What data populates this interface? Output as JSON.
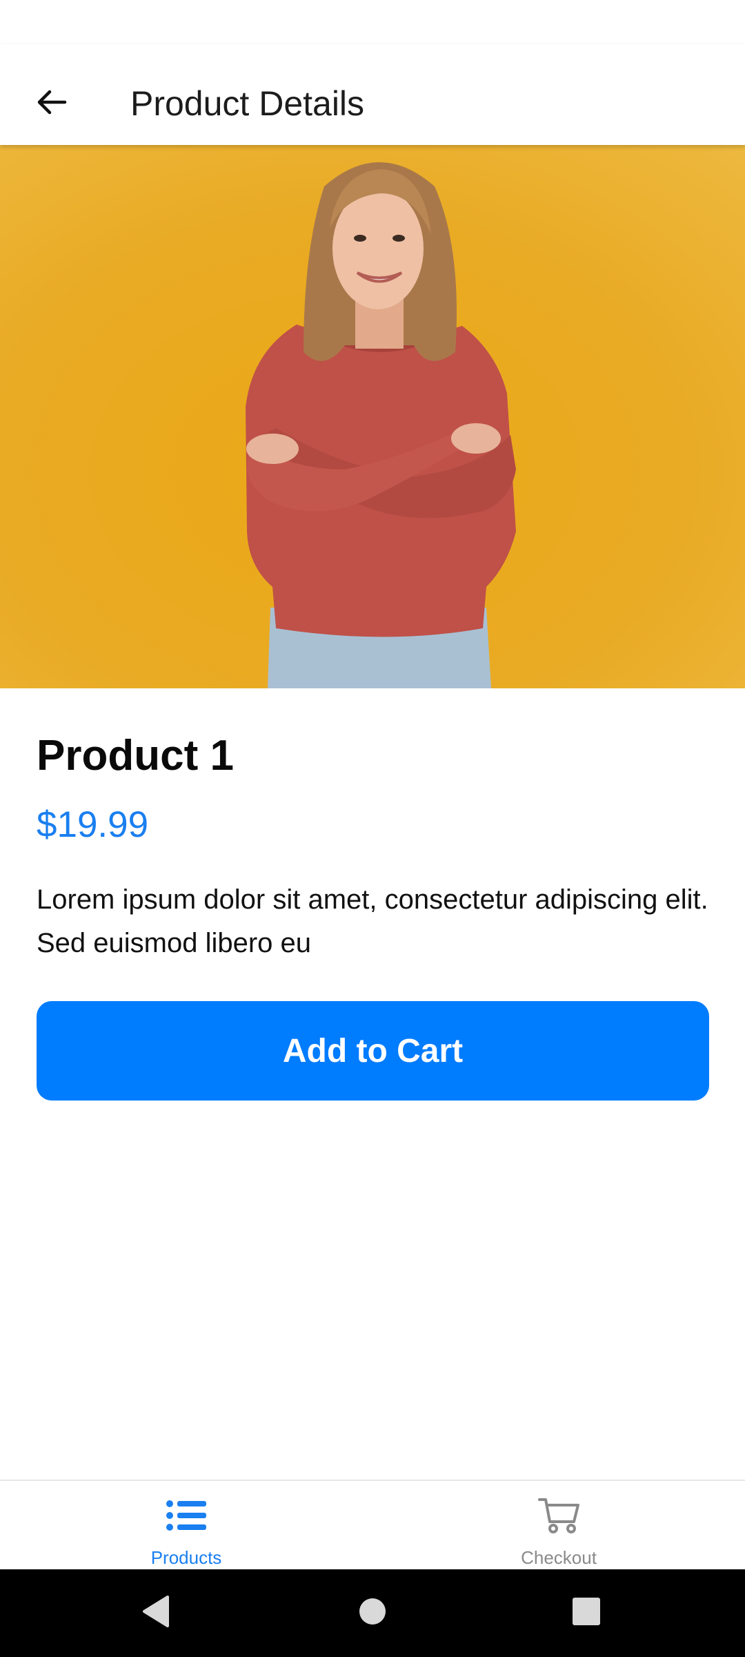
{
  "app_bar": {
    "title": "Product Details",
    "back_icon": "arrow-left-icon"
  },
  "product": {
    "name": "Product 1",
    "price": "$19.99",
    "description": "Lorem ipsum dolor sit amet, consectetur adipiscing elit. Sed euismod libero eu",
    "add_to_cart_label": "Add to Cart",
    "image": "product-photo-woman-red-sweater"
  },
  "bottom_nav": {
    "items": [
      {
        "label": "Products",
        "icon": "list-icon",
        "active": true
      },
      {
        "label": "Checkout",
        "icon": "cart-icon",
        "active": false
      }
    ]
  },
  "colors": {
    "accent": "#007cfe",
    "price": "#1a7ff0",
    "nav_active": "#1a7ff0",
    "nav_inactive": "#8a8a8a",
    "hero_background": "#eaaa1a"
  },
  "system_nav": {
    "buttons": [
      "back-triangle-icon",
      "home-circle-icon",
      "recents-square-icon"
    ]
  }
}
